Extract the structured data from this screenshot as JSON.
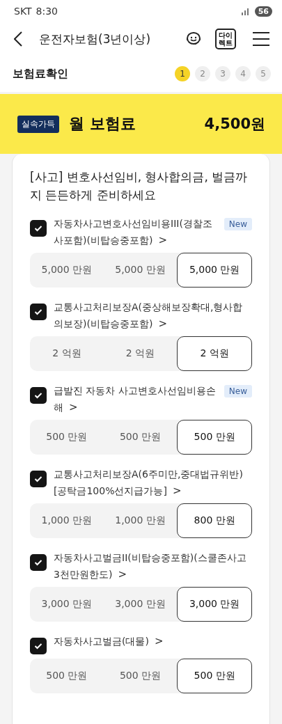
{
  "status_bar": {
    "carrier": "SKT",
    "time": "8:30",
    "battery": "56"
  },
  "header": {
    "title": "운전자보험(3년이상)",
    "direct_label": [
      "다이",
      "렉트"
    ]
  },
  "progress": {
    "label": "보험료확인",
    "steps": [
      {
        "label": "1",
        "selected": true
      },
      {
        "label": "2",
        "selected": false
      },
      {
        "label": "3",
        "selected": false
      },
      {
        "label": "4",
        "selected": false
      },
      {
        "label": "5",
        "selected": false
      }
    ]
  },
  "premium": {
    "badge": "실속가득",
    "label": "월 보험료",
    "amount": "4,500원"
  },
  "section": {
    "title": "[사고] 변호사선임비, 형사합의금, 벌금까지 든든하게 준비하세요",
    "more_mark": ">",
    "items": [
      {
        "title": "자동차사고변호사선임비용III(경찰조사포함)(비탑승중포함)",
        "checked": true,
        "badge": "New",
        "options": [
          {
            "label": "5,000 만원",
            "selected": false
          },
          {
            "label": "5,000 만원",
            "selected": false
          },
          {
            "label": "5,000 만원",
            "selected": true
          }
        ]
      },
      {
        "title": "교통사고처리보장A(중상해보장확대,형사합의보장)(비탑승중포함)",
        "checked": true,
        "options": [
          {
            "label": "2 억원",
            "selected": false
          },
          {
            "label": "2 억원",
            "selected": false
          },
          {
            "label": "2 억원",
            "selected": true
          }
        ]
      },
      {
        "title": "급발진 자동차 사고변호사선임비용손해",
        "checked": true,
        "badge": "New",
        "options": [
          {
            "label": "500 만원",
            "selected": false
          },
          {
            "label": "500 만원",
            "selected": false
          },
          {
            "label": "500 만원",
            "selected": true
          }
        ]
      },
      {
        "title": "교통사고처리보장A(6주미만,중대법규위반)[공탁금100%선지급가능]",
        "checked": true,
        "options": [
          {
            "label": "1,000 만원",
            "selected": false
          },
          {
            "label": "1,000 만원",
            "selected": false
          },
          {
            "label": "800 만원",
            "selected": true
          }
        ]
      },
      {
        "title": "자동차사고벌금II(비탑승중포함)(스쿨존사고3천만원한도)",
        "checked": true,
        "options": [
          {
            "label": "3,000 만원",
            "selected": false
          },
          {
            "label": "3,000 만원",
            "selected": false
          },
          {
            "label": "3,000 만원",
            "selected": true
          }
        ]
      },
      {
        "title": "자동차사고벌금(대물)",
        "checked": true,
        "options": [
          {
            "label": "500 만원",
            "selected": false
          },
          {
            "label": "500 만원",
            "selected": false
          },
          {
            "label": "500 만원",
            "selected": true
          }
        ]
      }
    ]
  }
}
